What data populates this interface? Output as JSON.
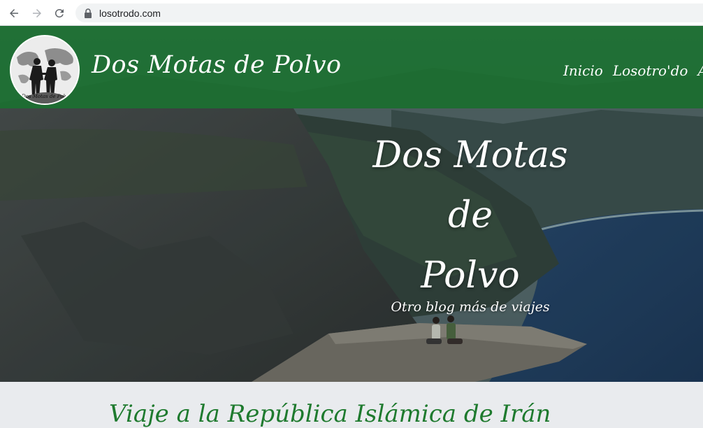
{
  "browser": {
    "url": "losotrodo.com",
    "icons": [
      "back-arrow-icon",
      "forward-arrow-icon",
      "reload-icon",
      "lock-icon"
    ]
  },
  "header": {
    "logo_caption": "Dos Motas de Polvo",
    "site_title": "Dos Motas de Polvo",
    "menu": [
      "Inicio",
      "Losotro'do",
      "An"
    ]
  },
  "hero": {
    "title_line1": "Dos Motas",
    "title_line2": "de",
    "title_line3": "Polvo",
    "tagline": "Otro blog más de viajes"
  },
  "post": {
    "title": "Viaje a la República Islámica de Irán"
  },
  "colors": {
    "header_green": "#186e2c",
    "post_title_green": "#1e7a2e",
    "page_bg": "#e9ebee"
  }
}
